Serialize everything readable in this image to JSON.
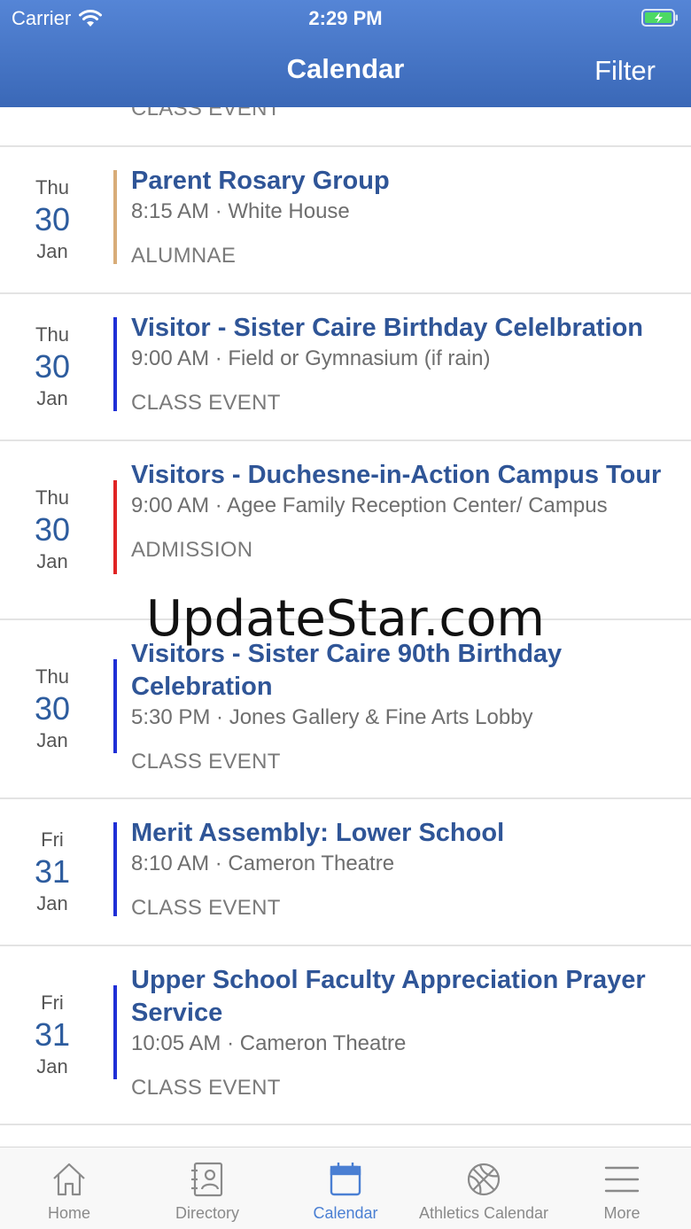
{
  "status_bar": {
    "carrier": "Carrier",
    "time": "2:29 PM"
  },
  "nav": {
    "title": "Calendar",
    "filter_label": "Filter"
  },
  "partial_row": {
    "category": "CLASS EVENT"
  },
  "events": [
    {
      "dow": "Thu",
      "day": "30",
      "month": "Jan",
      "title": "Parent Rosary Group",
      "time_location": "8:15 AM · White House",
      "category": "ALUMNAE",
      "color": "#d8ac78"
    },
    {
      "dow": "Thu",
      "day": "30",
      "month": "Jan",
      "title": "Visitor - Sister Caire Birthday Celelbration",
      "time_location": "9:00 AM · Field or Gymnasium (if rain)",
      "category": "CLASS EVENT",
      "color": "#1f2fd6"
    },
    {
      "dow": "Thu",
      "day": "30",
      "month": "Jan",
      "title": "Visitors - Duchesne-in-Action Campus Tour",
      "time_location": "9:00 AM · Agee Family Reception Center/ Campus",
      "category": "ADMISSION",
      "color": "#e02424"
    },
    {
      "dow": "Thu",
      "day": "30",
      "month": "Jan",
      "title": "Visitors - Sister Caire 90th Birthday Celebration",
      "time_location": "5:30 PM · Jones Gallery & Fine Arts Lobby",
      "category": "CLASS EVENT",
      "color": "#1f2fd6"
    },
    {
      "dow": "Fri",
      "day": "31",
      "month": "Jan",
      "title": "Merit Assembly: Lower School",
      "time_location": "8:10 AM · Cameron Theatre",
      "category": "CLASS EVENT",
      "color": "#1f2fd6"
    },
    {
      "dow": "Fri",
      "day": "31",
      "month": "Jan",
      "title": "Upper School Faculty Appreciation Prayer Service",
      "time_location": "10:05 AM · Cameron Theatre",
      "category": "CLASS EVENT",
      "color": "#1f2fd6"
    }
  ],
  "watermark": "UpdateStar.com",
  "tabs": [
    {
      "label": "Home",
      "icon": "home-icon"
    },
    {
      "label": "Directory",
      "icon": "directory-icon"
    },
    {
      "label": "Calendar",
      "icon": "calendar-icon",
      "active": true
    },
    {
      "label": "Athletics Calendar",
      "icon": "basketball-icon"
    },
    {
      "label": "More",
      "icon": "menu-icon"
    }
  ],
  "colors": {
    "header_top": "#5585d6",
    "header_bottom": "#3a68b7",
    "title_blue": "#2f5597",
    "tab_active": "#4a7fd3"
  }
}
